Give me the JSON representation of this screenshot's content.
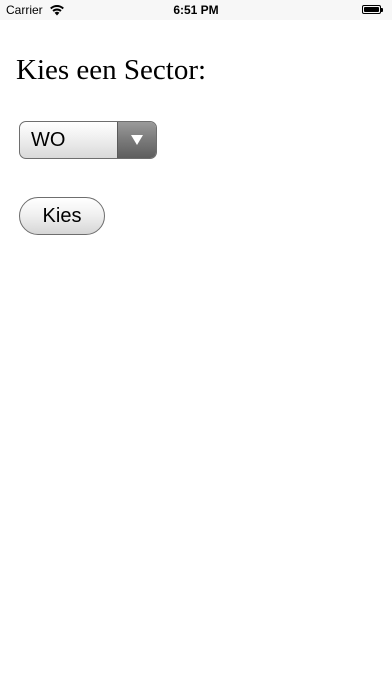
{
  "status_bar": {
    "carrier": "Carrier",
    "time": "6:51 PM",
    "icons": [
      "wifi-icon",
      "battery-icon"
    ]
  },
  "main": {
    "title": "Kies een Sector:",
    "sector_select": {
      "selected_value": "WO"
    },
    "submit_button": {
      "label": "Kies"
    }
  }
}
